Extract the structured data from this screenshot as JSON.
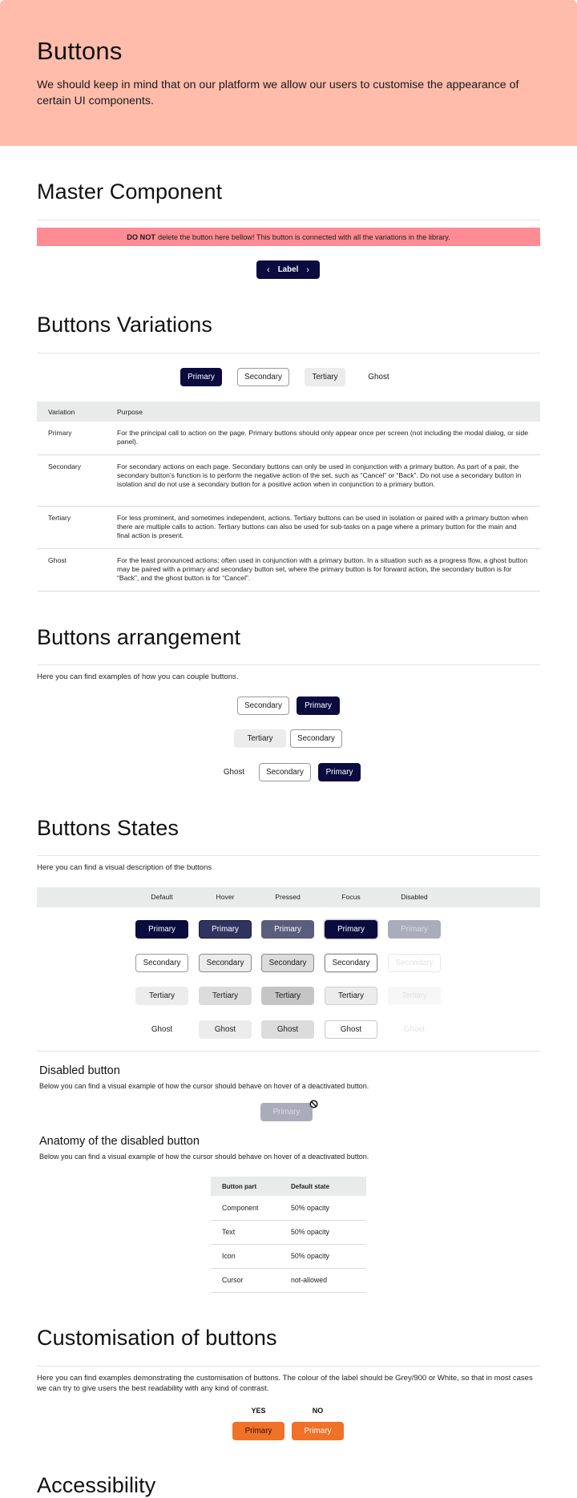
{
  "hero": {
    "title": "Buttons",
    "description": "We should keep in mind that on our platform we allow our users to customise the appearance of certain UI components.",
    "background": "#ffbcab"
  },
  "master": {
    "title": "Master Component",
    "warning_bold": "DO NOT",
    "warning_text": "delete the button here bellow! This button is connected with all the variations in the library.",
    "warning_color": "#ff8c95",
    "button": {
      "label": "Label",
      "left_icon": "chevron-left",
      "right_icon": "chevron-right"
    }
  },
  "variations": {
    "title": "Buttons Variations",
    "buttons": [
      "Primary",
      "Secondary",
      "Tertiary",
      "Ghost"
    ],
    "table": {
      "headers": [
        "Variation",
        "Purpose"
      ],
      "rows": [
        {
          "variation": "Primary",
          "purpose": "For the principal call to action on the page. Primary buttons should only appear once per screen (not including the modal dialog, or side panel)."
        },
        {
          "variation": "Secondary",
          "purpose": "For secondary actions on each page. Secondary buttons can only be used in conjunction with a primary button. As part of a pair, the secondary button’s function is to perform the negative action of the set, such as “Cancel” or “Back”. Do not use a secondary button in isolation and do not use a secondary button for a positive action when in conjunction to a primary button."
        },
        {
          "variation": "Tertiary",
          "purpose": "For less prominent, and sometimes independent, actions. Tertiary buttons can be used in isolation or paired with a primary button when there are multiple calls to action. Tertiary buttons can also be used for sub-tasks on a page where a primary button for the main and final action is present."
        },
        {
          "variation": "Ghost",
          "purpose": "For the least pronounced actions; often used in conjunction with a primary button. In a situation such as a progress flow, a ghost button may be paired with a primary and secondary button set, where the primary button is for forward action, the secondary button is for “Back”, and the ghost button is for “Cancel”."
        }
      ]
    }
  },
  "arrangement": {
    "title": "Buttons arrangement",
    "description": "Here you can find examples of how you can couple buttons.",
    "rows": [
      [
        "Secondary",
        "Primary"
      ],
      [
        "Tertiary",
        "Secondary"
      ],
      [
        "Ghost",
        "Secondary",
        "Primary"
      ]
    ]
  },
  "states": {
    "title": "Buttons States",
    "description": "Here you can find a visual description of the buttons",
    "columns": [
      "Default",
      "Hover",
      "Pressed",
      "Focus",
      "Disabled"
    ],
    "rows": [
      "Primary",
      "Secondary",
      "Tertiary",
      "Ghost"
    ],
    "primary_color": "#0b0b3f"
  },
  "disabled": {
    "title": "Disabled button",
    "description": "Below you can find a visual example of how the cursor should behave on hover of a deactivated button.",
    "button_label": "Primary",
    "cursor_icon": "not-allowed"
  },
  "anatomy": {
    "title": "Anatomy of the disabled button",
    "description": "Below you can find a visual example of how the cursor should behave on hover of a deactivated button.",
    "headers": [
      "Button part",
      "Default state"
    ],
    "rows": [
      [
        "Component",
        "50% opacity"
      ],
      [
        "Text",
        "50% opacity"
      ],
      [
        "Icon",
        "50% opacity"
      ],
      [
        "Cursor",
        "not-allowed"
      ]
    ]
  },
  "customisation": {
    "title": "Customisation of buttons",
    "description": "Here you can find examples demonstrating the customisation of buttons. The colour of the label should be Grey/900 or White, so that in most cases we can try to give users the best readability with any kind of contrast.",
    "yes_label": "YES",
    "no_label": "NO",
    "button_label": "Primary",
    "accent": "#f07128"
  },
  "accessibility": {
    "title": "Accessibility"
  }
}
